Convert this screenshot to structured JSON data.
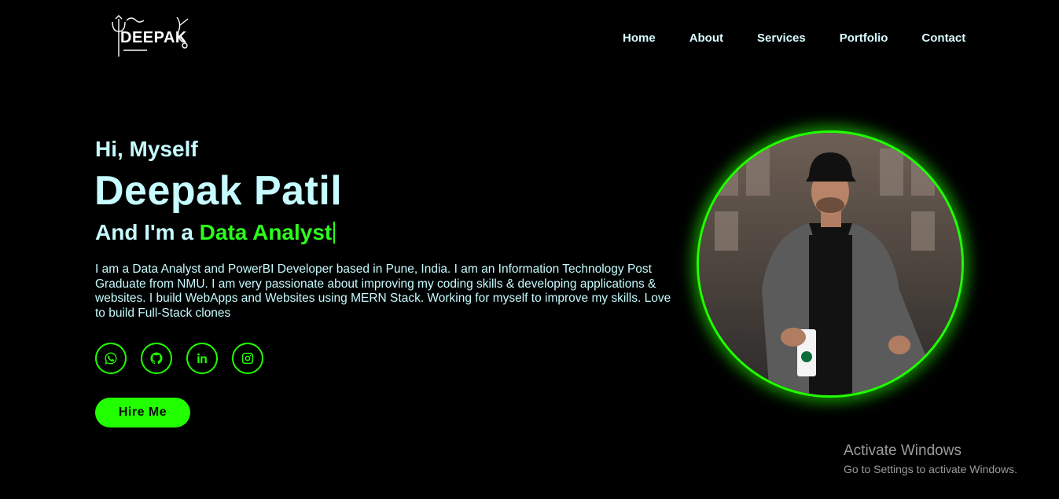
{
  "logo": {
    "text": "DEEPAK"
  },
  "nav": {
    "items": [
      "Home",
      "About",
      "Services",
      "Portfolio",
      "Contact"
    ]
  },
  "hero": {
    "greeting": "Hi, Myself",
    "name": "Deepak Patil",
    "role_prefix": "And I'm a ",
    "role_typed": "Data Analyst",
    "bio": "I am a Data Analyst and PowerBI Developer based in Pune, India. I am an Information Technology Post Graduate from NMU. I am very passionate about improving my coding skills & developing applications & websites. I build WebApps and Websites using MERN Stack. Working for myself to improve my skills. Love to build Full-Stack clones",
    "hire_button": "Hire Me"
  },
  "socials": [
    "whatsapp-icon",
    "github-icon",
    "linkedin-icon",
    "instagram-icon"
  ],
  "colors": {
    "accent": "#22ff00",
    "text": "#c6fbff",
    "background": "#000000"
  },
  "watermark": {
    "title": "Activate Windows",
    "subtitle": "Go to Settings to activate Windows."
  }
}
